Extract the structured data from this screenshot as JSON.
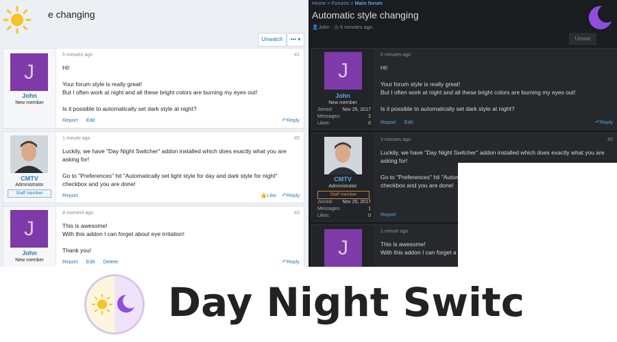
{
  "light": {
    "title": "e changing",
    "unwatch": "Unwatch",
    "more": "•••",
    "posts": [
      {
        "time": "5 minutes ago",
        "num": "#1",
        "avatar_letter": "J",
        "name": "John",
        "role": "New member",
        "lines": [
          "Hi!",
          "",
          "Your forum style is really great!",
          "But I often work at night and all these bright colors are burning my eyes out!",
          "",
          "Is it possible to automatically set dark style at night?"
        ],
        "actions": [
          "Report",
          "Edit"
        ],
        "reply": "Reply"
      },
      {
        "time": "1 minute ago",
        "num": "#2",
        "name": "CMTV",
        "role": "Administrator",
        "badge": "Staff member",
        "lines": [
          "Luckily, we have \"Day Night Switcher\" addon installed which does exactly what you are",
          "asking for!",
          "",
          "Go to \"Preferences\" hit \"Automatically set light style for day and dark style for night\"",
          "checkbox and you are done!"
        ],
        "actions": [
          "Report"
        ],
        "like": "Like",
        "reply": "Reply"
      },
      {
        "time": "A moment ago",
        "num": "#3",
        "avatar_letter": "J",
        "name": "John",
        "role": "New member",
        "lines": [
          "This is awesome!",
          "With this addon I can forget about eye irritation!",
          "",
          "Thank you!"
        ],
        "actions": [
          "Report",
          "Edit",
          "Delete"
        ],
        "reply": "Reply"
      }
    ]
  },
  "dark": {
    "crumbs": [
      "Home",
      "Forums",
      "Main forum"
    ],
    "title": "Automatic style changing",
    "author": "John",
    "ago": "6 minutes ago",
    "unwatch": "Unwat",
    "posts": [
      {
        "time": "6 minutes ago",
        "avatar_letter": "J",
        "name": "John",
        "role": "New member",
        "stats": [
          [
            "Joined:",
            "Nov 25, 2017"
          ],
          [
            "Messages:",
            "2"
          ],
          [
            "Likes:",
            "0"
          ]
        ],
        "lines": [
          "Hi!",
          "",
          "Your forum style is really great!",
          "But I often work at night and all these bright colors are burning my eyes out!",
          "",
          "Is it possible to automatically set dark style at night?"
        ],
        "actions": [
          "Report",
          "Edit"
        ],
        "reply": "Reply"
      },
      {
        "time": "3 minutes ago",
        "num": "#2",
        "name": "CMTV",
        "role": "Administrator",
        "badge": "Staff member",
        "stats": [
          [
            "Joined:",
            "Nov 25, 2017"
          ],
          [
            "Messages:",
            "1"
          ],
          [
            "Likes:",
            "0"
          ]
        ],
        "lines": [
          "Luckily, we have \"Day Night Switcher\" addon installed which does exactly what you are",
          "asking for!",
          "",
          "Go to \"Preferences\" hit \"Autom",
          "checkbox and you are done!"
        ],
        "actions": [
          "Report"
        ]
      },
      {
        "time": "1 minute ago",
        "avatar_letter": "J",
        "lines": [
          "This is awesome!",
          "With this addon I can forget a"
        ]
      }
    ]
  },
  "banner": {
    "title": "Day Night Switc"
  },
  "colors": {
    "link": "#2577b1",
    "dark_link": "#5ea3e6",
    "avatar": "#7e3aa8",
    "sun": "#f7c325",
    "moon": "#8e4ee0"
  }
}
